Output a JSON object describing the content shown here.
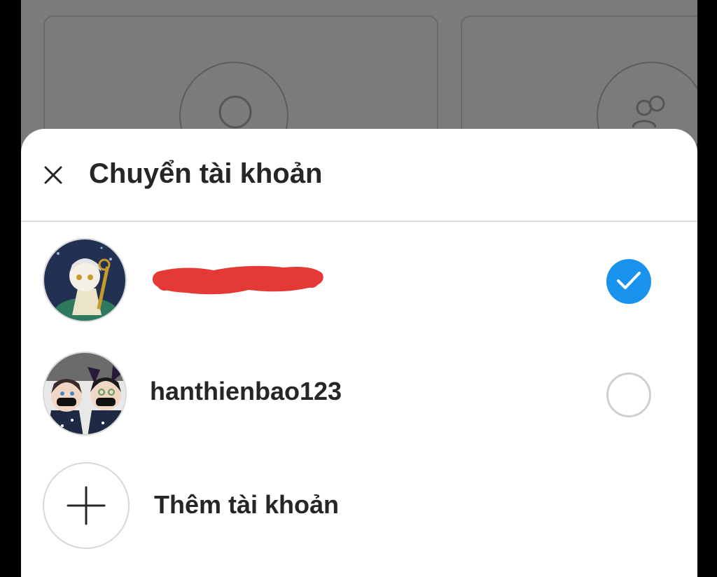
{
  "sheet": {
    "title": "Chuyển tài khoản"
  },
  "accounts": [
    {
      "username": "",
      "selected": true,
      "username_redacted": true
    },
    {
      "username": "hanthienbao123",
      "selected": false
    }
  ],
  "add_account": {
    "label": "Thêm tài khoản"
  },
  "colors": {
    "accent": "#1a93ef",
    "redaction": "#e53935",
    "overlay": "#7b7b7b"
  },
  "icons": {
    "close": "close-icon",
    "check": "checkmark-icon",
    "plus": "plus-icon",
    "profile": "profile-icon",
    "group": "group-icon"
  }
}
